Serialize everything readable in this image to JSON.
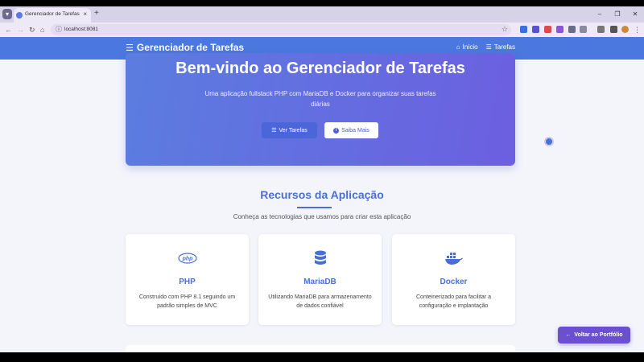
{
  "browser": {
    "tab_title": "Gerenciador de Tarefas",
    "tab_close": "×",
    "new_tab": "+",
    "url": "localhost:8081",
    "window": {
      "minimize": "–",
      "restore": "❐",
      "close": "✕"
    }
  },
  "header": {
    "brand": "Gerenciador de Tarefas",
    "nav": [
      {
        "label": "Início",
        "icon": "home-icon"
      },
      {
        "label": "Tarefas",
        "icon": "tasks-icon"
      }
    ]
  },
  "hero": {
    "title": "Bem-vindo ao Gerenciador de Tarefas",
    "subtitle": "Uma aplicação fullstack PHP com MariaDB e Docker para organizar suas tarefas diárias",
    "primary_button": "Ver Tarefas",
    "secondary_button": "Saiba Mais"
  },
  "features": {
    "title": "Recursos da Aplicação",
    "subtitle": "Conheça as tecnologias que usamos para criar esta aplicação",
    "cards": [
      {
        "title": "PHP",
        "description": "Construído com PHP 8.1 seguindo um padrão simples de MVC",
        "icon": "php-icon",
        "icon_text": "php"
      },
      {
        "title": "MariaDB",
        "description": "Utilizando MariaDB para armazenamento de dados confiável",
        "icon": "database-icon"
      },
      {
        "title": "Docker",
        "description": "Conteinerizado para facilitar a configuração e implantação",
        "icon": "docker-icon"
      }
    ]
  },
  "floating_button": "Voltar ao Portfólio",
  "colors": {
    "header": "#4a78de",
    "accent": "#4a6fd4",
    "hero_start": "#5b7de0",
    "hero_end": "#6c5fe0",
    "floating_button": "#6a4fd0"
  }
}
